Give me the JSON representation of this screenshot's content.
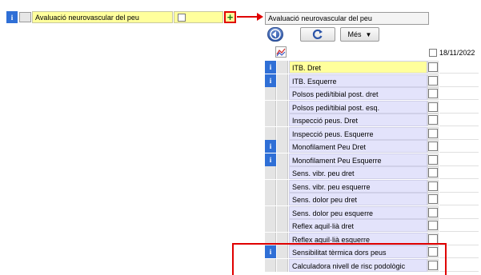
{
  "left_row": {
    "badge": "i",
    "label": "Avaluació neurovascular del peu",
    "plus_symbol": "+"
  },
  "panel": {
    "title": "Avaluació neurovascular del peu",
    "back_icon": "circle-arrow-left-icon",
    "refresh_icon": "refresh-icon",
    "more_label": "Més",
    "more_arrow": "▼",
    "chart_icon": "line-chart-icon",
    "date": "18/11/2022",
    "rows": [
      {
        "badge": "i",
        "label": "ITB. Dret",
        "selected": true
      },
      {
        "badge": "i",
        "label": "ITB. Esquerre",
        "selected": false
      },
      {
        "badge": "",
        "label": "Polsos pedi/tibial post. dret",
        "selected": false
      },
      {
        "badge": "",
        "label": "Polsos pedi/tibial post. esq.",
        "selected": false
      },
      {
        "badge": "",
        "label": "Inspecció peus. Dret",
        "selected": false
      },
      {
        "badge": "",
        "label": "Inspecció peus. Esquerre",
        "selected": false
      },
      {
        "badge": "i",
        "label": "Monofilament Peu Dret",
        "selected": false
      },
      {
        "badge": "i",
        "label": "Monofilament Peu Esquerre",
        "selected": false
      },
      {
        "badge": "",
        "label": "Sens. vibr. peu dret",
        "selected": false
      },
      {
        "badge": "",
        "label": "Sens. vibr. peu esquerre",
        "selected": false
      },
      {
        "badge": "",
        "label": "Sens. dolor peu dret",
        "selected": false
      },
      {
        "badge": "",
        "label": "Sens. dolor peu esquerre",
        "selected": false
      },
      {
        "badge": "",
        "label": "Reflex aquil·lià dret",
        "selected": false
      },
      {
        "badge": "",
        "label": "Reflex aquil·lià esquerre",
        "selected": false
      },
      {
        "badge": "i",
        "label": "Sensibilitat tèrmica dors peus",
        "selected": false
      },
      {
        "badge": "",
        "label": "Calculadora nivell de risc podològic",
        "selected": false
      }
    ]
  },
  "colors": {
    "badge_blue": "#2f6fd6",
    "highlight_red": "#e00000",
    "row_lavender": "#e3e3fb",
    "row_yellow": "#ffff9c"
  }
}
